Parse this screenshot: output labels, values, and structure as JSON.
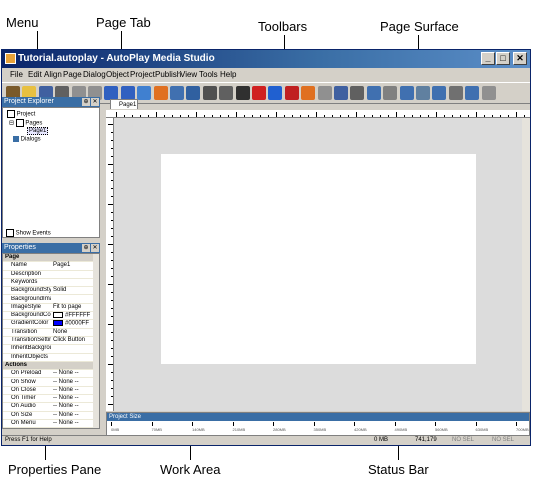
{
  "callouts": {
    "menu": "Menu",
    "page_tab": "Page Tab",
    "toolbars": "Toolbars",
    "page_surface": "Page Surface",
    "properties_pane": "Properties Pane",
    "work_area": "Work Area",
    "status_bar": "Status Bar"
  },
  "window": {
    "title": "Tutorial.autoplay - AutoPlay Media Studio",
    "minimize": "_",
    "maximize": "□",
    "close": "✕"
  },
  "menu": [
    "File",
    "Edit",
    "Align",
    "Page",
    "Dialog",
    "Object",
    "Project",
    "Publish",
    "View",
    "Tools",
    "Help"
  ],
  "toolbar": {
    "icons": [
      "wand-icon",
      "open-icon",
      "save-icon",
      "cut-icon",
      "copy-icon",
      "paste-icon",
      "undo-icon",
      "redo-icon",
      "preview-icon",
      "publish-icon",
      "button-obj-icon",
      "image-obj-icon",
      "label-obj-icon",
      "paragraph-obj-icon",
      "video-obj-icon",
      "flash-obj-icon",
      "web-obj-icon",
      "pdf-obj-icon",
      "slideshow-obj-icon",
      "input-obj-icon",
      "checkbox-obj-icon",
      "radio-obj-icon",
      "listbox-obj-icon",
      "combobox-obj-icon",
      "progress-obj-icon",
      "tree-obj-icon",
      "grid-obj-icon",
      "slider-obj-icon",
      "plugin-obj-icon",
      "pencil-icon"
    ],
    "colors": [
      "#7a5a2a",
      "#e8c040",
      "#4060a0",
      "#606060",
      "#909090",
      "#909090",
      "#3060c0",
      "#3060c0",
      "#4080d0",
      "#e07020",
      "#4070b0",
      "#3060a0",
      "#505050",
      "#606060",
      "#303030",
      "#d02020",
      "#2060d0",
      "#c02020",
      "#e07020",
      "#909090",
      "#4060a0",
      "#606060",
      "#4070b0",
      "#808080",
      "#4070b0",
      "#6080a0",
      "#4070b0",
      "#707070",
      "#4070b0",
      "#909090"
    ]
  },
  "explorer": {
    "title": "Project Explorer",
    "root": "Project",
    "pages": "Pages",
    "page1": "Page1",
    "dialogs": "Dialogs",
    "show_events": "Show Events"
  },
  "properties": {
    "title": "Properties",
    "rows": [
      {
        "k": "Page",
        "v": "",
        "section": true
      },
      {
        "k": "Name",
        "v": "Page1"
      },
      {
        "k": "Description",
        "v": ""
      },
      {
        "k": "Keywords",
        "v": ""
      },
      {
        "k": "BackgroundStyle",
        "v": "Solid"
      },
      {
        "k": "BackgroundImage",
        "v": ""
      },
      {
        "k": "ImageStyle",
        "v": "Fit to page"
      },
      {
        "k": "BackgroundColor",
        "v": "#FFFFFF",
        "swatch": "#ffffff"
      },
      {
        "k": "GradientColor",
        "v": "#0000FF",
        "swatch": "#0000ff"
      },
      {
        "k": "Transition",
        "v": "None"
      },
      {
        "k": "TransitionSettings",
        "v": "Click Button"
      },
      {
        "k": "InheritBackground",
        "v": ""
      },
      {
        "k": "InheritObjects",
        "v": ""
      },
      {
        "k": "Actions",
        "v": "",
        "section": true
      },
      {
        "k": "On Preload",
        "v": "-- None --"
      },
      {
        "k": "On Show",
        "v": "-- None --"
      },
      {
        "k": "On Close",
        "v": "-- None --"
      },
      {
        "k": "On Timer",
        "v": "-- None --"
      },
      {
        "k": "On Audio",
        "v": "-- None --"
      },
      {
        "k": "On Size",
        "v": "-- None --"
      },
      {
        "k": "On Menu",
        "v": "-- None --"
      }
    ]
  },
  "page_tab": "Page1",
  "project_size": {
    "title": "Project Size",
    "ticks": [
      "0MB",
      "70MB",
      "140MB",
      "210MB",
      "280MB",
      "350MB",
      "420MB",
      "490MB",
      "560MB",
      "630MB",
      "700MB"
    ]
  },
  "status": {
    "help": "Press F1 for Help",
    "size": "0 MB",
    "coords": "741,179",
    "nosel1": "NO SEL",
    "nosel2": "NO SEL"
  }
}
